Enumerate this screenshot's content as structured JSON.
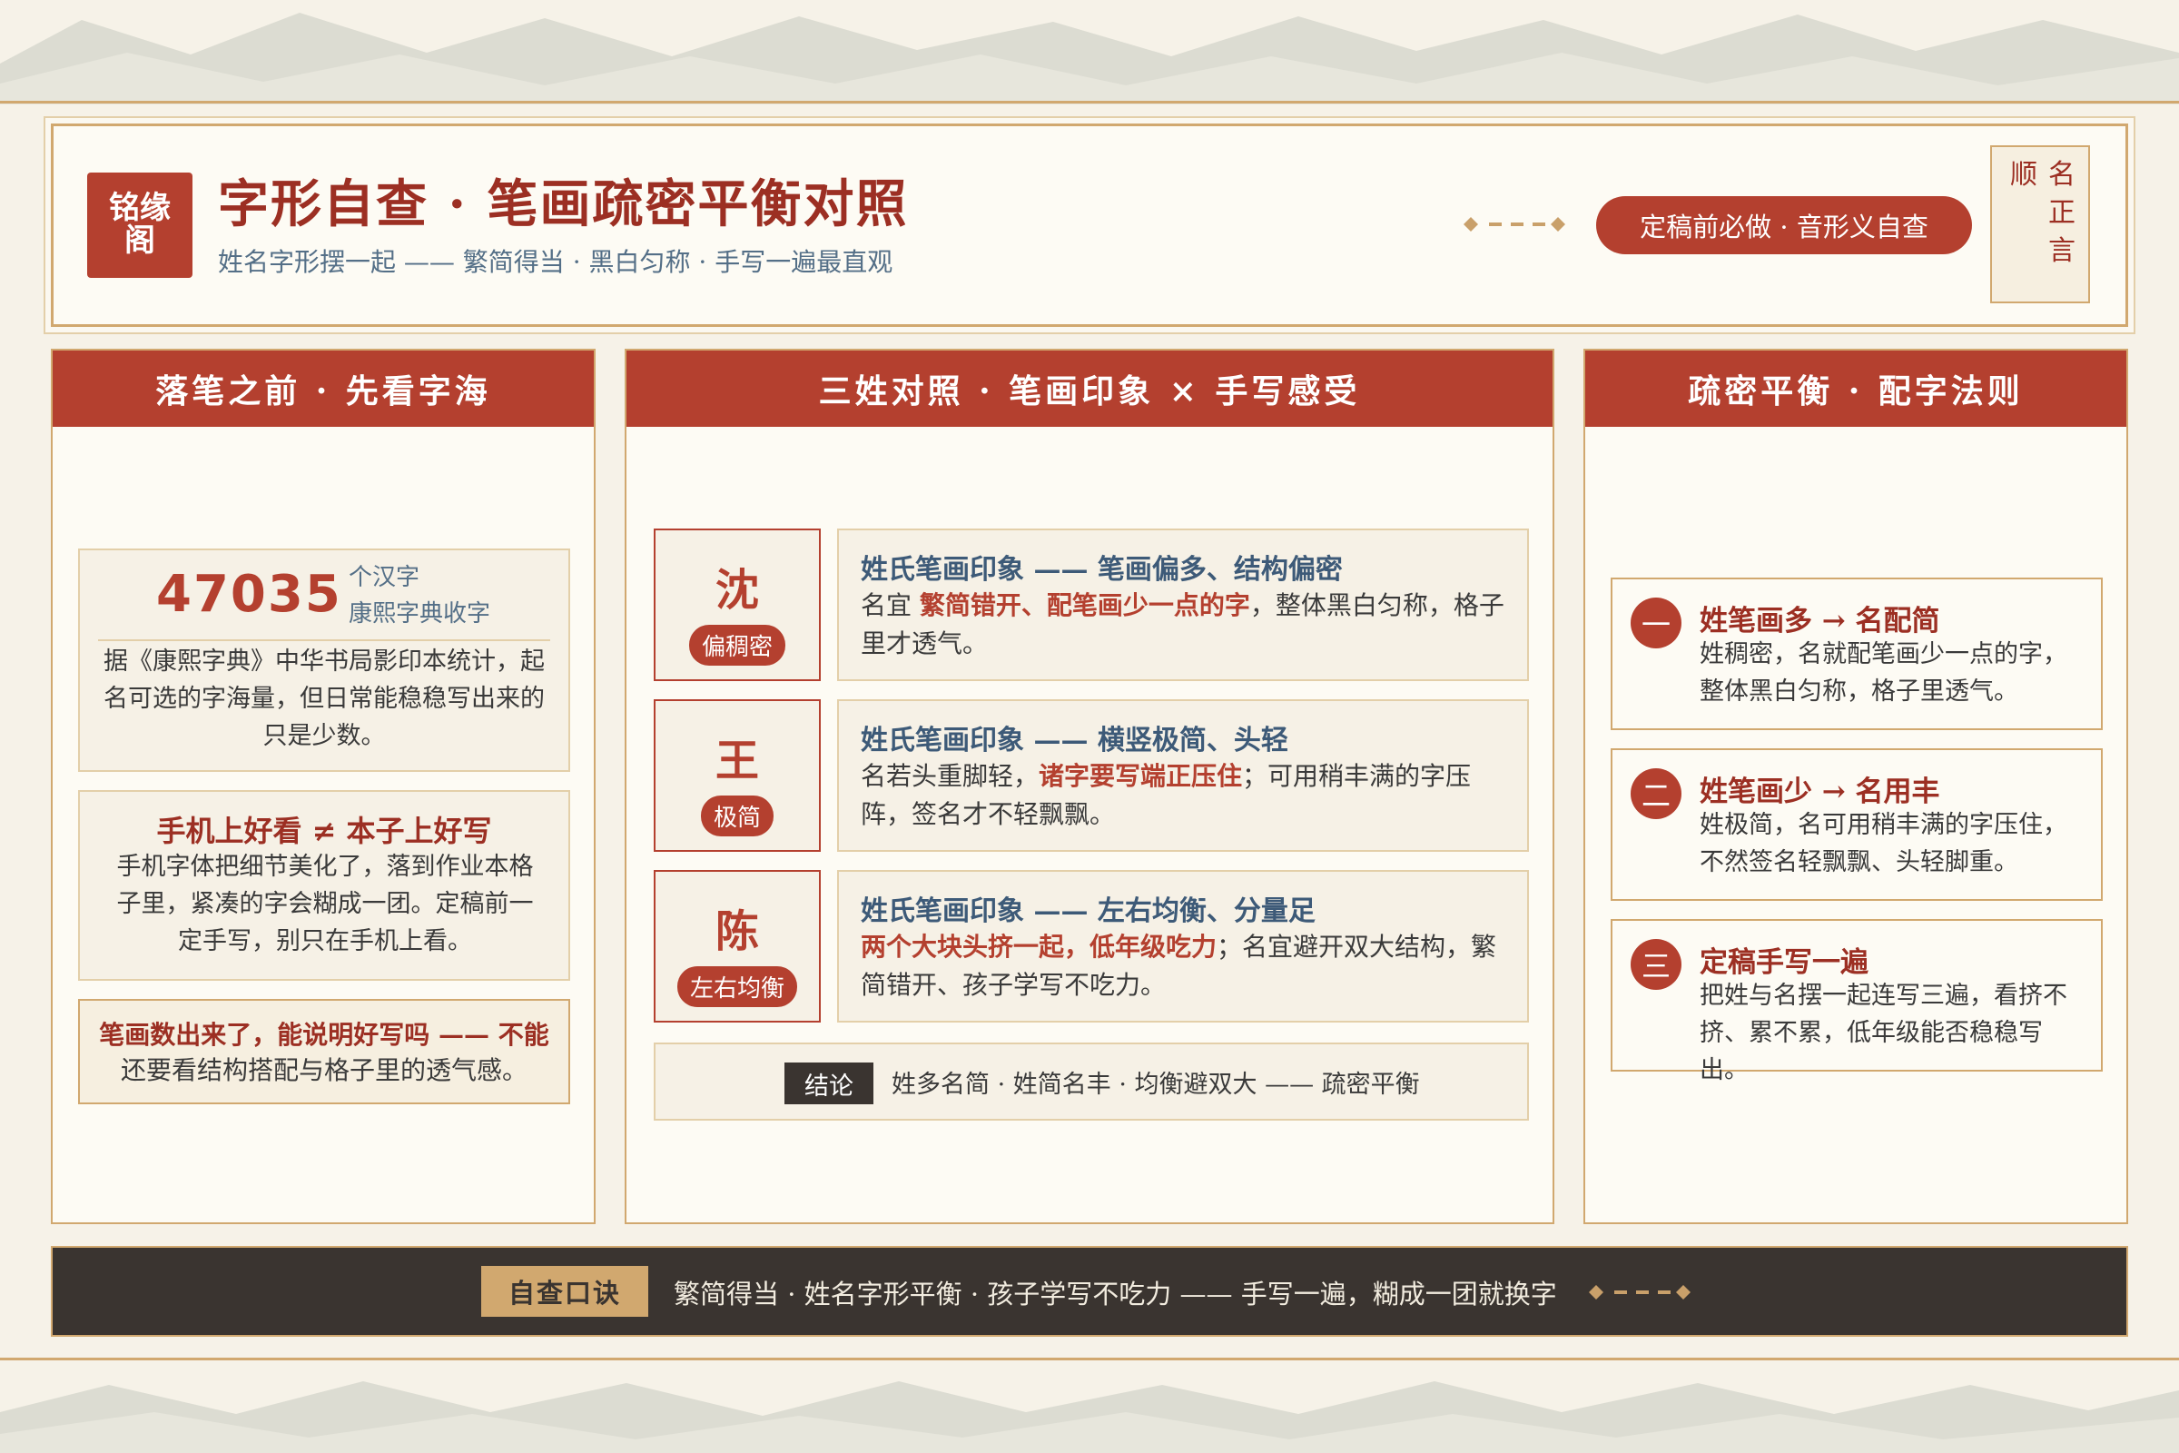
{
  "header": {
    "logo": "铭缘阁",
    "title": "字形自查 · 笔画疏密平衡对照",
    "subtitle": "姓名字形摆一起 —— 繁简得当 · 黑白匀称 · 手写一遍最直观",
    "pill": "定稿前必做 · 音形义自查",
    "seal": [
      "名",
      "正",
      "言",
      "顺"
    ]
  },
  "left_panel": {
    "heading": "落笔之前 · 先看字海",
    "stat": {
      "number": "47035",
      "unit": "个汉字",
      "source": "康熙字典收字",
      "text": "据《康熙字典》中华书局影印本统计，起名可选的字海量，但日常能稳稳写出来的只是少数。"
    },
    "card2": {
      "title": "手机上好看 ≠ 本子上好写",
      "text": "手机字体把细节美化了，落到作业本格子里，紧凑的字会糊成一团。定稿前一定手写，别只在手机上看。"
    },
    "card3": {
      "title": "笔画数出来了，能说明好写吗 —— 不能",
      "text": "还要看结构搭配与格子里的透气感。"
    }
  },
  "middle_panel": {
    "heading": "三姓对照 · 笔画印象 × 手写感受",
    "rows": [
      {
        "char": "沈",
        "tag": "偏稠密",
        "title": "姓氏笔画印象 —— 笔画偏多、结构偏密",
        "pre": "名宜 ",
        "hl": "繁简错开、配笔画少一点的字",
        "post": "，整体黑白匀称，格子里才透气。"
      },
      {
        "char": "王",
        "tag": "极简",
        "title": "姓氏笔画印象 —— 横竖极简、头轻",
        "pre": "名若头重脚轻，",
        "hl": "诸字要写端正压住",
        "post": "；可用稍丰满的字压阵，签名才不轻飘飘。"
      },
      {
        "char": "陈",
        "tag": "左右均衡",
        "title": "姓氏笔画印象 —— 左右均衡、分量足",
        "pre": "",
        "hl": "两个大块头挤一起，低年级吃力",
        "post": "；名宜避开双大结构，繁简错开、孩子学写不吃力。"
      }
    ],
    "conclusion": {
      "tag": "结论",
      "text": "姓多名简 · 姓简名丰 · 均衡避双大 —— 疏密平衡"
    }
  },
  "right_panel": {
    "heading": "疏密平衡 · 配字法则",
    "rules": [
      {
        "num": "一",
        "title": "姓笔画多 → 名配简",
        "text": "姓稠密，名就配笔画少一点的字，整体黑白匀称，格子里透气。"
      },
      {
        "num": "二",
        "title": "姓笔画少 → 名用丰",
        "text": "姓极简，名可用稍丰满的字压住，不然签名轻飘飘、头轻脚重。"
      },
      {
        "num": "三",
        "title": "定稿手写一遍",
        "text": "把姓与名摆一起连写三遍，看挤不挤、累不累，低年级能否稳稳写出。"
      }
    ]
  },
  "footer": {
    "tag": "自查口诀",
    "text": "繁简得当 · 姓名字形平衡 · 孩子学写不吃力 —— 手写一遍，糊成一团就换字"
  },
  "colors": {
    "accent": "#b4402f",
    "gold": "#d1a86f",
    "dark": "#3a3430",
    "blue": "#3d5a78",
    "background": "#f6f2e8"
  }
}
